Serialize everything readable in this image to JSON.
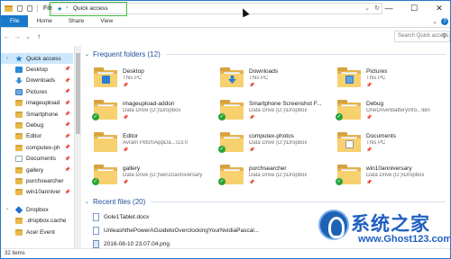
{
  "window": {
    "title": "File Explorer",
    "controls": {
      "minimize": "—",
      "maximize": "☐",
      "close": "✕"
    }
  },
  "ribbon": {
    "tabs": [
      "File",
      "Home",
      "Share",
      "View"
    ],
    "help": "?",
    "expand": "⌄"
  },
  "address": {
    "path": "Quick access",
    "search_placeholder": "Search Quick access"
  },
  "nav_pane": {
    "items": [
      {
        "label": "Quick access",
        "icon": "star-icon",
        "pinned": false
      },
      {
        "label": "Desktop",
        "icon": "desktop-icon",
        "pinned": true
      },
      {
        "label": "Downloads",
        "icon": "download-icon",
        "pinned": true
      },
      {
        "label": "Pictures",
        "icon": "pictures-icon",
        "pinned": true
      },
      {
        "label": "imageupload",
        "icon": "folder-icon",
        "pinned": true
      },
      {
        "label": "Smartphone",
        "icon": "folder-icon",
        "pinned": true
      },
      {
        "label": "Debug",
        "icon": "folder-icon",
        "pinned": true
      },
      {
        "label": "Editor",
        "icon": "folder-icon",
        "pinned": true
      },
      {
        "label": "computex-ph",
        "icon": "folder-icon",
        "pinned": true
      },
      {
        "label": "Documents",
        "icon": "documents-icon",
        "pinned": true
      },
      {
        "label": "gallery",
        "icon": "folder-icon",
        "pinned": true
      },
      {
        "label": "purchsearcher",
        "icon": "folder-icon",
        "pinned": false
      },
      {
        "label": "win10anniver",
        "icon": "folder-icon",
        "pinned": true
      },
      {
        "label": "Dropbox",
        "icon": "dropbox-icon",
        "pinned": false
      },
      {
        "label": ".dropbox.cache",
        "icon": "folder-icon",
        "pinned": false
      },
      {
        "label": "Acer Event",
        "icon": "folder-icon",
        "pinned": false
      }
    ],
    "pin_glyph": "📌"
  },
  "frequent": {
    "title": "Frequent folders (12)",
    "folders": [
      {
        "name": "Desktop",
        "location": "This PC",
        "overlay": "desk",
        "synced": false
      },
      {
        "name": "Downloads",
        "location": "This PC",
        "overlay": "dl",
        "synced": false
      },
      {
        "name": "Pictures",
        "location": "This PC",
        "overlay": "pic",
        "synced": false
      },
      {
        "name": "imageupload-addon",
        "location": "Data Drive (D:)\\Dropbox",
        "overlay": "",
        "synced": true
      },
      {
        "name": "Smartphone Screenshot F...",
        "location": "Data Drive (D:)\\Dropbox",
        "overlay": "",
        "synced": true
      },
      {
        "name": "Debug",
        "location": "OneDrive\\BatteryInfo...\\bin",
        "overlay": "",
        "synced": true
      },
      {
        "name": "Editor",
        "location": "Avram Piltch\\AppDa...\\13.0",
        "overlay": "",
        "synced": false
      },
      {
        "name": "computex-photos",
        "location": "Data Drive (D:)\\Dropbox",
        "overlay": "",
        "synced": true
      },
      {
        "name": "Documents",
        "location": "This PC",
        "overlay": "doc",
        "synced": false
      },
      {
        "name": "gallery",
        "location": "Data Drive (D:)\\win10anniversary",
        "overlay": "",
        "synced": true
      },
      {
        "name": "purchsearcher",
        "location": "Data Drive (D:)\\Dropbox",
        "overlay": "",
        "synced": true
      },
      {
        "name": "win10anniversary",
        "location": "Data Drive (D:)\\Dropbox",
        "overlay": "",
        "synced": true
      }
    ]
  },
  "recent": {
    "title": "Recent files (20)",
    "files": [
      {
        "name": "Gole1Tablet.docx",
        "type": "doc"
      },
      {
        "name": "UnleashthePowerAGuidetoOverclockingYourNvidiaPascal...",
        "type": "doc"
      },
      {
        "name": "2016-08-10 23.07.04.png",
        "type": "img"
      }
    ]
  },
  "status": {
    "items": "32 items"
  },
  "watermark": {
    "text": "系统之家",
    "url": "www.Ghost123.com"
  }
}
